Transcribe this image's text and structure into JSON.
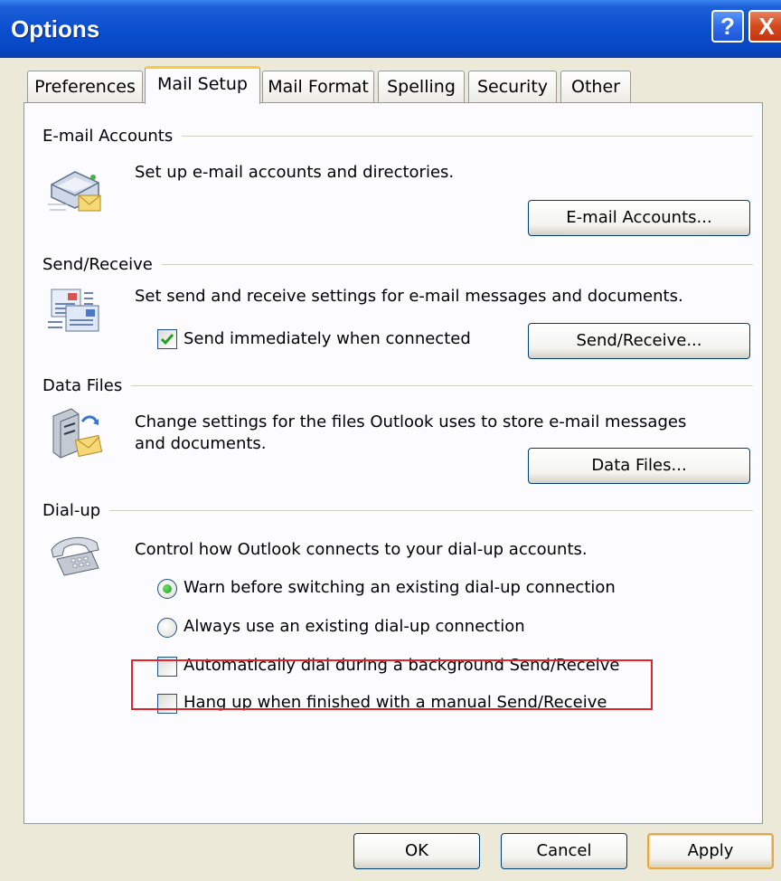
{
  "window": {
    "title": "Options",
    "help_glyph": "?",
    "close_glyph": "X"
  },
  "tabs": [
    {
      "label": "Preferences",
      "active": false
    },
    {
      "label": "Mail Setup",
      "active": true
    },
    {
      "label": "Mail Format",
      "active": false
    },
    {
      "label": "Spelling",
      "active": false
    },
    {
      "label": "Security",
      "active": false
    },
    {
      "label": "Other",
      "active": false
    }
  ],
  "email_accounts": {
    "title": "E-mail Accounts",
    "description": "Set up e-mail accounts and directories.",
    "button": "E-mail Accounts...",
    "icon": "email-accounts-icon"
  },
  "send_receive": {
    "title": "Send/Receive",
    "description": "Set send and receive settings for e-mail messages and documents.",
    "checkbox_label": "Send immediately when connected",
    "checkbox_checked": true,
    "button": "Send/Receive...",
    "icon": "send-receive-icon"
  },
  "data_files": {
    "title": "Data Files",
    "description_line1": "Change settings for the files Outlook uses to store e-mail messages",
    "description_line2": "and documents.",
    "button": "Data Files...",
    "icon": "data-files-icon"
  },
  "dialup": {
    "title": "Dial-up",
    "description": "Control how Outlook connects to your dial-up accounts.",
    "radio_warn": "Warn before switching an existing dial-up connection",
    "radio_warn_selected": true,
    "radio_always": "Always use an existing dial-up connection",
    "radio_always_selected": false,
    "check_auto_dial": "Automatically dial during a background Send/Receive",
    "check_auto_dial_checked": false,
    "check_hang_up": "Hang up when finished with a manual Send/Receive",
    "check_hang_up_checked": false,
    "icon": "telephone-icon",
    "highlight_color": "#e2252b"
  },
  "footer": {
    "ok": "OK",
    "cancel": "Cancel",
    "apply": "Apply"
  }
}
